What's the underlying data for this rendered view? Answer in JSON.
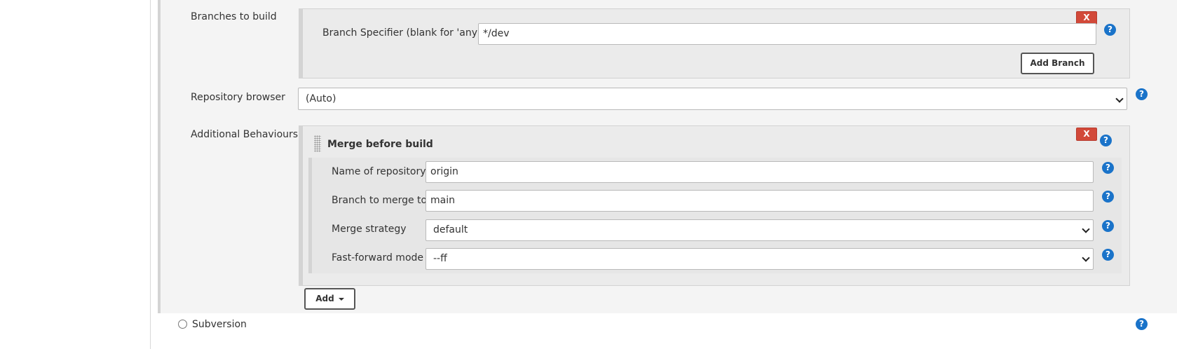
{
  "branches": {
    "label": "Branches to build",
    "specifier_label": "Branch Specifier (blank for 'any')",
    "specifier_value": "*/dev",
    "delete_label": "X",
    "add_branch_label": "Add Branch"
  },
  "repository_browser": {
    "label": "Repository browser",
    "selected": "(Auto)"
  },
  "additional_behaviours": {
    "label": "Additional Behaviours",
    "behaviour_title": "Merge before build",
    "delete_label": "X",
    "fields": {
      "repo_name_label": "Name of repository",
      "repo_name_value": "origin",
      "merge_target_label": "Branch to merge to",
      "merge_target_value": "main",
      "strategy_label": "Merge strategy",
      "strategy_value": "default",
      "ff_label": "Fast-forward mode",
      "ff_value": "--ff"
    },
    "add_label": "Add"
  },
  "scm_option": {
    "label": "Subversion"
  },
  "help_glyph": "?",
  "colors": {
    "delete_red": "#d24939",
    "help_blue": "#1a73c9",
    "panel_gray": "#ebebeb",
    "section_bg": "#f4f4f4"
  }
}
